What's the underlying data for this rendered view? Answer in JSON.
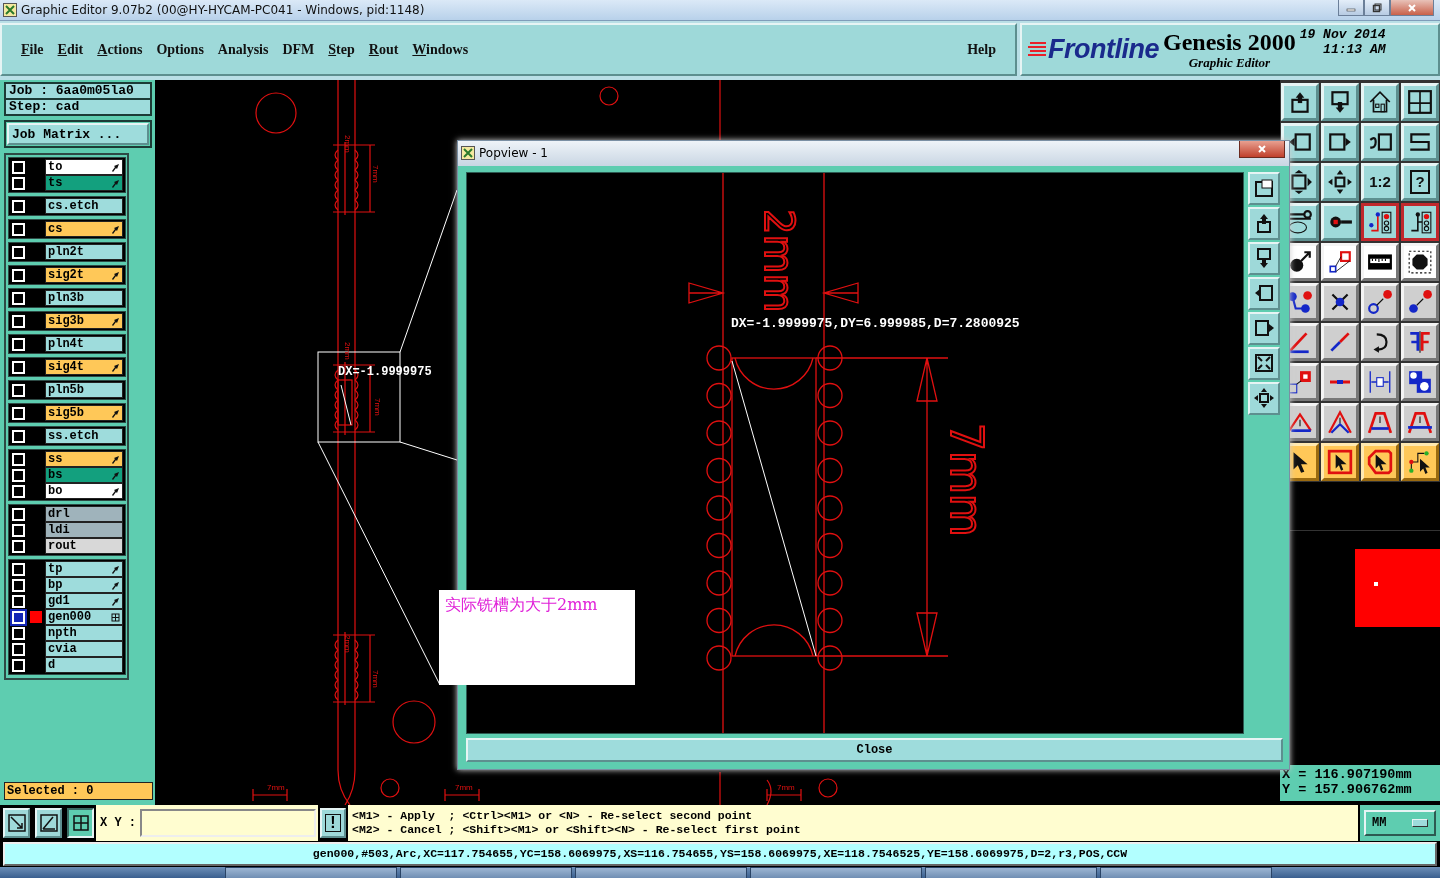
{
  "window": {
    "title": "Graphic Editor 9.07b2 (00@HY-HYCAM-PC041 - Windows, pid:1148)"
  },
  "menu": [
    {
      "label": "File",
      "mnemonic": true
    },
    {
      "label": "Edit",
      "mnemonic": true
    },
    {
      "label": "Actions",
      "mnemonic": true
    },
    {
      "label": "Options",
      "mnemonic": false
    },
    {
      "label": "Analysis",
      "mnemonic": false
    },
    {
      "label": "DFM",
      "mnemonic": false
    },
    {
      "label": "Step",
      "mnemonic": true
    },
    {
      "label": "Rout",
      "mnemonic": true
    },
    {
      "label": "Windows",
      "mnemonic": true
    }
  ],
  "help": "Help",
  "branding": {
    "logo": "Frontline",
    "product": "Genesis 2000",
    "subtitle": "Graphic Editor",
    "date": "19 Nov 2014",
    "time": "11:13 AM"
  },
  "job": {
    "job": "Job : 6aa0m05la0",
    "step": "Step: cad",
    "matrix_button": "Job Matrix ..."
  },
  "layer_groups": [
    {
      "layers": [
        {
          "name": "to",
          "color": "#ffffff",
          "arrow": true,
          "active": false
        },
        {
          "name": "ts",
          "color": "#13a07e",
          "arrow": true,
          "active": false
        }
      ]
    },
    {
      "layers": [
        {
          "name": "cs.etch",
          "color": "#9edcdc",
          "arrow": false,
          "active": false
        }
      ]
    },
    {
      "layers": [
        {
          "name": "cs",
          "color": "#ffc858",
          "arrow": true,
          "active": false
        }
      ]
    },
    {
      "layers": [
        {
          "name": "pln2t",
          "color": "#9edcdc",
          "arrow": false,
          "active": false
        }
      ]
    },
    {
      "layers": [
        {
          "name": "sig2t",
          "color": "#ffc858",
          "arrow": true,
          "active": false
        }
      ]
    },
    {
      "layers": [
        {
          "name": "pln3b",
          "color": "#9edcdc",
          "arrow": false,
          "active": false
        }
      ]
    },
    {
      "layers": [
        {
          "name": "sig3b",
          "color": "#ffc858",
          "arrow": true,
          "active": false
        }
      ]
    },
    {
      "layers": [
        {
          "name": "pln4t",
          "color": "#9edcdc",
          "arrow": false,
          "active": false
        }
      ]
    },
    {
      "layers": [
        {
          "name": "sig4t",
          "color": "#ffc858",
          "arrow": true,
          "active": false
        }
      ]
    },
    {
      "layers": [
        {
          "name": "pln5b",
          "color": "#9edcdc",
          "arrow": false,
          "active": false
        }
      ]
    },
    {
      "layers": [
        {
          "name": "sig5b",
          "color": "#ffc858",
          "arrow": true,
          "active": false
        }
      ]
    },
    {
      "layers": [
        {
          "name": "ss.etch",
          "color": "#9edcdc",
          "arrow": false,
          "active": false
        }
      ]
    },
    {
      "layers": [
        {
          "name": "ss",
          "color": "#ffc858",
          "arrow": true,
          "active": false
        },
        {
          "name": "bs",
          "color": "#13a07e",
          "arrow": true,
          "active": false
        },
        {
          "name": "bo",
          "color": "#ffffff",
          "arrow": true,
          "active": false
        }
      ]
    },
    {
      "layers": [
        {
          "name": "drl",
          "color": "#9fb3bb",
          "arrow": false,
          "active": false
        },
        {
          "name": "ldi",
          "color": "#9fb3bb",
          "arrow": false,
          "active": false
        },
        {
          "name": "rout",
          "color": "#d8d8d8",
          "arrow": false,
          "active": false
        }
      ]
    },
    {
      "layers": [
        {
          "name": "tp",
          "color": "#9edcdc",
          "arrow": true,
          "active": false
        },
        {
          "name": "bp",
          "color": "#9edcdc",
          "arrow": true,
          "active": false
        },
        {
          "name": "gd1",
          "color": "#9edcdc",
          "arrow": true,
          "active": false
        },
        {
          "name": "gen000",
          "color": "#9edcdc",
          "arrow": false,
          "active": true
        },
        {
          "name": "npth",
          "color": "#9edcdc",
          "arrow": false,
          "active": false
        },
        {
          "name": "cvia",
          "color": "#9edcdc",
          "arrow": false,
          "active": false
        },
        {
          "name": "d",
          "color": "#9edcdc",
          "arrow": false,
          "active": false
        }
      ]
    }
  ],
  "selected_count": "Selected : 0",
  "canvas": {
    "dimension_labels": [
      "2mm",
      "7mm",
      "2mm",
      "7mm",
      "2mm",
      "7mm",
      "7mm",
      "7mm",
      "7mm"
    ],
    "callout_label": "DX=-1.9999975",
    "note": "实际铣槽为大于2mm"
  },
  "popview": {
    "title": "Popview - 1",
    "measurement": "DX=-1.9999975,DY=6.999985,D=7.2800925",
    "dimension_labels": [
      "2mm",
      "7mm"
    ],
    "close_button": "Close"
  },
  "tools": [
    {
      "kind": "view",
      "on": false
    },
    {
      "kind": "view",
      "on": false
    },
    {
      "kind": "view",
      "on": false
    },
    {
      "kind": "view",
      "on": false
    },
    {
      "kind": "view",
      "on": false
    },
    {
      "kind": "view",
      "on": false
    },
    {
      "kind": "view",
      "on": false
    },
    {
      "kind": "view",
      "on": false
    },
    {
      "kind": "view",
      "on": false
    },
    {
      "kind": "view",
      "on": false
    },
    {
      "kind": "view",
      "on": false,
      "label": "1:2"
    },
    {
      "kind": "view",
      "on": false,
      "label": "?"
    },
    {
      "kind": "view",
      "on": false
    },
    {
      "kind": "view",
      "on": false
    },
    {
      "kind": "view",
      "on": true
    },
    {
      "kind": "view",
      "on": true
    },
    {
      "kind": "snap",
      "on": false
    },
    {
      "kind": "snap",
      "on": false
    },
    {
      "kind": "snap",
      "on": false
    },
    {
      "kind": "snap",
      "on": false
    },
    {
      "kind": "edit",
      "on": false
    },
    {
      "kind": "edit",
      "on": false
    },
    {
      "kind": "edit",
      "on": false
    },
    {
      "kind": "edit",
      "on": false
    },
    {
      "kind": "edit",
      "on": false
    },
    {
      "kind": "edit",
      "on": false
    },
    {
      "kind": "edit",
      "on": false
    },
    {
      "kind": "edit",
      "on": false
    },
    {
      "kind": "edit",
      "on": false
    },
    {
      "kind": "edit",
      "on": false
    },
    {
      "kind": "edit",
      "on": false
    },
    {
      "kind": "edit",
      "on": false
    },
    {
      "kind": "edit",
      "on": false
    },
    {
      "kind": "edit",
      "on": false
    },
    {
      "kind": "edit",
      "on": false
    },
    {
      "kind": "edit",
      "on": false
    },
    {
      "kind": "select",
      "on": false
    },
    {
      "kind": "select",
      "on": false
    },
    {
      "kind": "select",
      "on": false
    },
    {
      "kind": "select",
      "on": false
    }
  ],
  "coordinates": {
    "x": "X = 116.907190mm",
    "y": "Y = 157.906762mm"
  },
  "command_bar": {
    "xy_label": "X Y :",
    "alert_button": "!",
    "prompt": [
      "<M1> - Apply  ; <Ctrl><M1> or <N> - Re-select second point",
      "<M2> - Cancel ; <Shift><M1> or <Shift><N> - Re-select first point"
    ],
    "units": "MM"
  },
  "status_line": "gen000,#503,Arc,XC=117.754655,YC=158.6069975,XS=116.754655,YS=158.6069975,XE=118.7546525,YE=158.6069975,D=2,r3,POS,CCW"
}
